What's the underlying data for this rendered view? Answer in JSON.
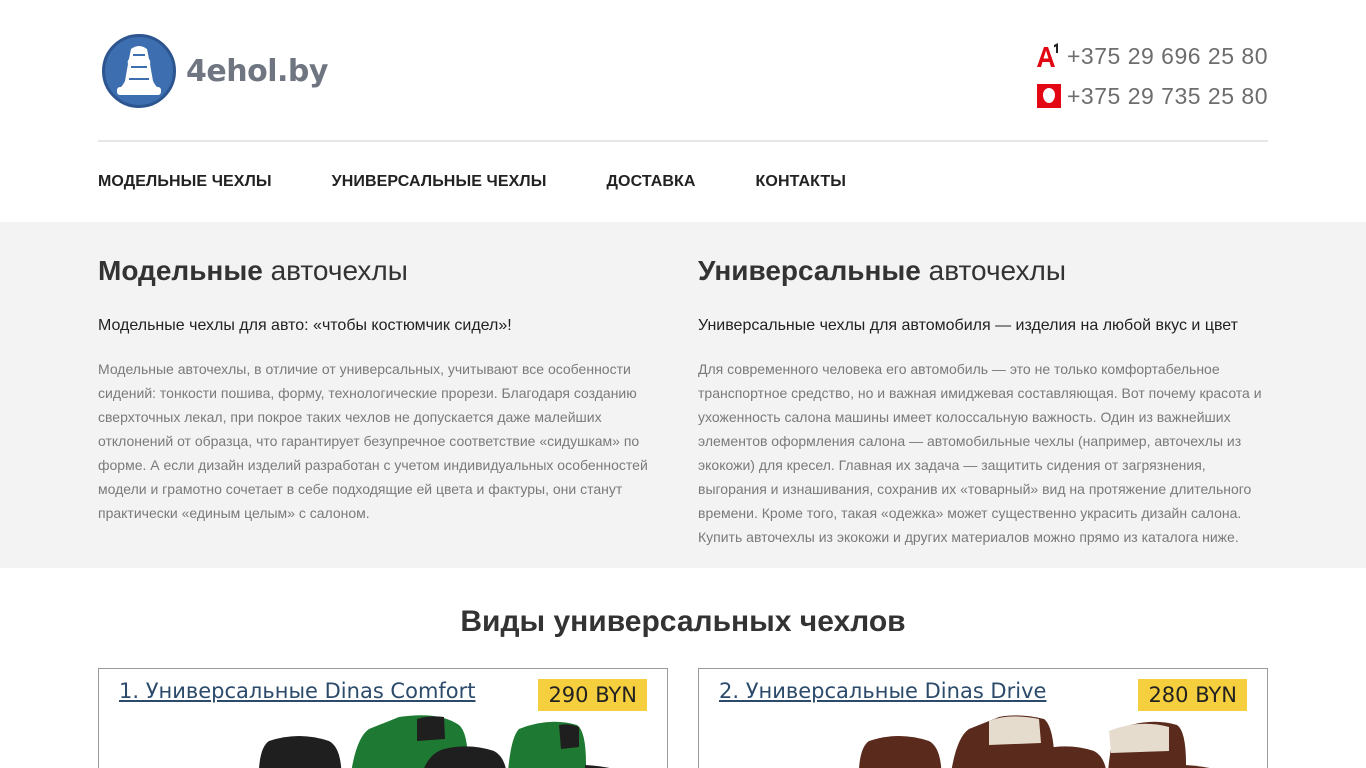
{
  "header": {
    "logo_text": "4ehol.by",
    "phones": [
      {
        "operator": "A1",
        "number": "+375 29 696 25 80"
      },
      {
        "operator": "MTS",
        "number": "+375 29 735 25 80"
      }
    ]
  },
  "nav": {
    "items": [
      {
        "label": "МОДЕЛЬНЫЕ ЧЕХЛЫ"
      },
      {
        "label": "УНИВЕРСАЛЬНЫЕ ЧЕХЛЫ"
      },
      {
        "label": "ДОСТАВКА"
      },
      {
        "label": "КОНТАКТЫ"
      }
    ]
  },
  "intro": {
    "model": {
      "title_bold": "Модельные",
      "title_rest": " авточехлы",
      "subtitle": "Модельные чехлы для авто: «чтобы костюмчик сидел»!",
      "text": "Модельные авточехлы, в отличие от универсальных, учитывают все особенности сидений: тонкости пошива, форму, технологические прорези. Благодаря созданию сверхточных лекал, при покрое таких чехлов не допускается даже малейших отклонений от образца, что гарантирует безупречное соответствие «сидушкам» по форме. А если дизайн изделий разработан с учетом индивидуальных особенностей модели и грамотно сочетает в себе подходящие ей цвета и фактуры, они станут практически «единым целым» с салоном."
    },
    "universal": {
      "title_bold": "Универсальные",
      "title_rest": " авточехлы",
      "subtitle": "Универсальные чехлы для автомобиля — изделия на любой вкус и цвет",
      "text": "Для современного человека его автомобиль — это не только комфортабельное транспортное средство, но и важная имиджевая составляющая. Вот почему красота и ухоженность салона машины имеет колоссальную важность. Один из важнейших элементов оформления салона — автомобильные чехлы (например, авточехлы из экокожи) для кресел. Главная их задача — защитить сидения от загрязнения, выгорания и изнашивания, сохранив их «товарный» вид на протяжение длительного времени. Кроме того, такая «одежка» может существенно украсить дизайн салона. Купить авточехлы из экокожи и других материалов можно прямо из каталога ниже."
    }
  },
  "types": {
    "title_bold": "Виды",
    "title_rest": " универсальных чехлов",
    "cards": [
      {
        "title": "1. Универсальные Dinas Comfort",
        "price": "290 BYN",
        "colors": {
          "a": "#1f1f1f",
          "b": "#1e7a32"
        }
      },
      {
        "title": "2. Универсальные Dinas Drive",
        "price": "280 BYN",
        "colors": {
          "a": "#5a2a1c",
          "b": "#e6dccd"
        }
      }
    ]
  },
  "colors": {
    "accent_price": "#f5cf3d",
    "link": "#2c4b6b",
    "logo_blue": "#3d6fb0",
    "band_bg": "#f3f3f3"
  }
}
